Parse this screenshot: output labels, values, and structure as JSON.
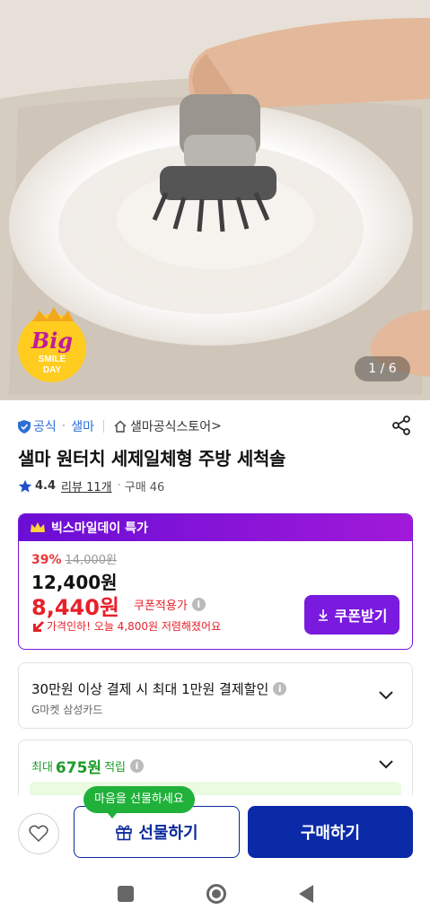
{
  "hero": {
    "counter": "1 / 6",
    "badge": {
      "line1": "Big",
      "line2": "SMILE",
      "line3": "DAY"
    }
  },
  "product": {
    "official_label": "공식",
    "brand": "샐마",
    "store": "샐마공식스토어",
    "store_chevron": ">",
    "title": "샐마 원터치 세제일체형 주방 세척솔",
    "rating": "4.4",
    "review": "리뷰 11개",
    "purchase": "구매 46"
  },
  "deal": {
    "header": "빅스마일데이 특가",
    "discount_pct": "39%",
    "original_price": "14,000원",
    "price": "12,400원",
    "coupon_price": "8,440원",
    "coupon_apply_label": "쿠폰적용가",
    "price_down": "가격인하! 오늘 4,800원 저렴해졌어요",
    "coupon_button": "쿠폰받기"
  },
  "card_promo": {
    "title": "30만원 이상 결제 시 최대 1만원 결제할인",
    "subtitle": "G마켓 삼성카드"
  },
  "points": {
    "prefix": "최대",
    "amount": "675원",
    "suffix": "적립"
  },
  "bottom": {
    "tooltip": "마음을 선물하세요",
    "gift_button": "선물하기",
    "buy_button": "구매하기"
  },
  "colors": {
    "purple": "#7a1adf",
    "red": "#e8202a",
    "navy": "#0a2aa8",
    "green": "#20b13a"
  }
}
